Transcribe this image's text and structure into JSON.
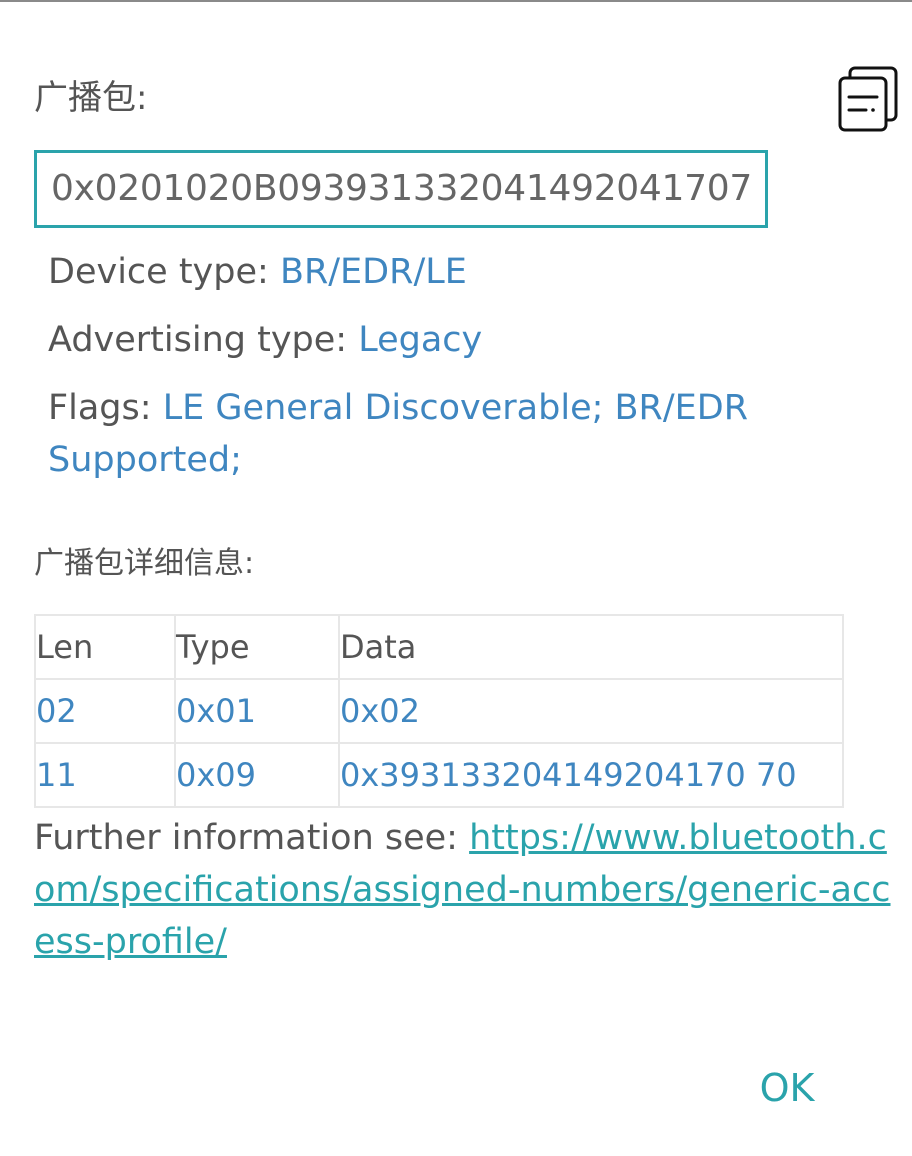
{
  "dialog": {
    "raw_label": "广播包:",
    "raw_value": "0x0201020B093931332041492041707",
    "device_type_label": "Device type: ",
    "device_type_value": "BR/EDR/LE",
    "adv_type_label": "Advertising type: ",
    "adv_type_value": "Legacy",
    "flags_label": "Flags: ",
    "flags_value": "LE General Discoverable; BR/EDR Supported;",
    "detail_label": "广播包详细信息:",
    "table": {
      "headers": [
        "Len",
        "Type",
        "Data"
      ],
      "rows": [
        [
          "02",
          "0x01",
          "0x02"
        ],
        [
          "11",
          "0x09",
          "0x393133204149204170 70"
        ]
      ]
    },
    "further_label": "Further information see: ",
    "further_link": "https://www.bluetooth.com/specifications/assigned-numbers/generic-access-profile/",
    "ok_label": "OK",
    "copy_icon": "copy-icon"
  },
  "colors": {
    "accent": "#2aa3ab",
    "value_blue": "#3f86c0",
    "text": "#555555"
  }
}
